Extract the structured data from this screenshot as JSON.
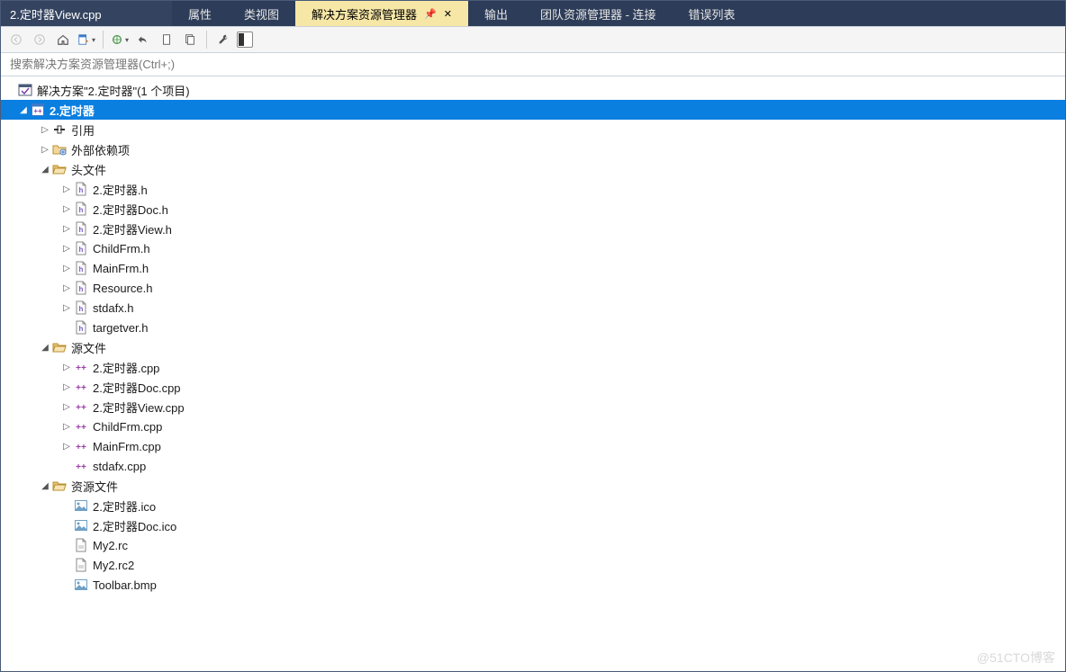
{
  "tabs": {
    "file": "2.定时器View.cpp",
    "items": [
      "属性",
      "类视图",
      "解决方案资源管理器",
      "输出",
      "团队资源管理器 - 连接",
      "错误列表"
    ],
    "active_index": 2
  },
  "toolbar": {
    "back": "后退",
    "forward": "前进",
    "home": "主页",
    "sync": "与活动文档同步",
    "refresh": "刷新",
    "collapse": "折叠",
    "showall": "显示所有文件",
    "props": "属性",
    "preview": "预览",
    "wrench": "属性",
    "mode": "查看模式"
  },
  "search": {
    "placeholder": "搜索解决方案资源管理器(Ctrl+;)"
  },
  "tree": {
    "solution": "解决方案\"2.定时器\"(1 个项目)",
    "project": "2.定时器",
    "refs": "引用",
    "externals": "外部依赖项",
    "headers": {
      "label": "头文件",
      "items": [
        "2.定时器.h",
        "2.定时器Doc.h",
        "2.定时器View.h",
        "ChildFrm.h",
        "MainFrm.h",
        "Resource.h",
        "stdafx.h",
        "targetver.h"
      ]
    },
    "sources": {
      "label": "源文件",
      "items": [
        "2.定时器.cpp",
        "2.定时器Doc.cpp",
        "2.定时器View.cpp",
        "ChildFrm.cpp",
        "MainFrm.cpp",
        "stdafx.cpp"
      ]
    },
    "resources": {
      "label": "资源文件",
      "items": [
        "2.定时器.ico",
        "2.定时器Doc.ico",
        "My2.rc",
        "My2.rc2",
        "Toolbar.bmp"
      ]
    }
  },
  "watermark": "@51CTO博客"
}
